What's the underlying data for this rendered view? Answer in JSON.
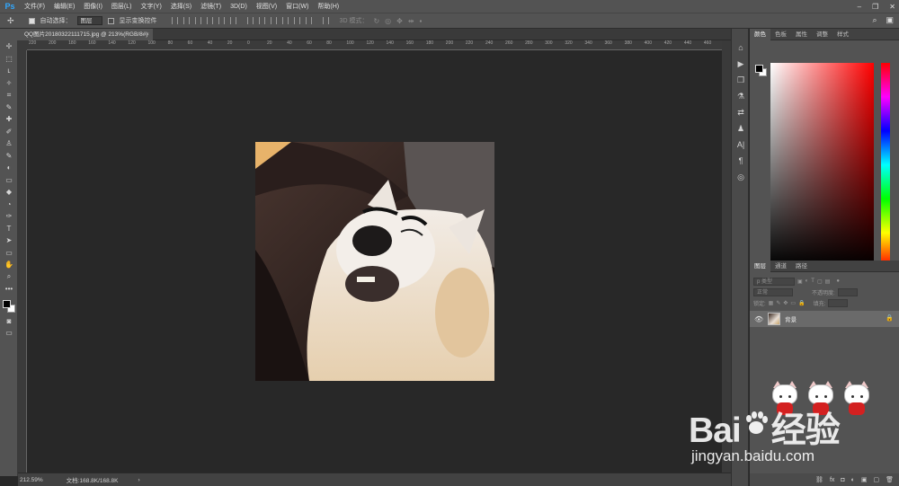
{
  "app": {
    "logo": "Ps"
  },
  "menu": {
    "items": [
      "文件(F)",
      "编辑(E)",
      "图像(I)",
      "图层(L)",
      "文字(Y)",
      "选择(S)",
      "滤镜(T)",
      "3D(D)",
      "视图(V)",
      "窗口(W)",
      "帮助(H)"
    ]
  },
  "window_controls": {
    "minimize": "–",
    "restore": "❐",
    "close": "✕"
  },
  "options": {
    "tool_glyph": "✢",
    "auto_select_label": "自动选择：",
    "auto_select_value": "图层",
    "show_transform_label": "显示变换控件",
    "mode_3d_label": "3D 模式：",
    "search_glyph": "⌕",
    "workspace_glyph": "▣"
  },
  "document": {
    "tab_title": "QQ图片20180322111715.jpg @ 213%(RGB/8#)",
    "close_glyph": "×"
  },
  "ruler": {
    "top_labels": [
      "220",
      "200",
      "180",
      "160",
      "140",
      "120",
      "100",
      "80",
      "60",
      "40",
      "20",
      "0",
      "20",
      "40",
      "60",
      "80",
      "100",
      "120",
      "140",
      "160",
      "180",
      "200",
      "220",
      "240",
      "260",
      "280",
      "300",
      "320",
      "340",
      "360",
      "380",
      "400",
      "420",
      "440",
      "460"
    ]
  },
  "status": {
    "zoom": "212.59%",
    "doc_info": "文档:168.8K/168.8K",
    "arrow": "›"
  },
  "tools": [
    "✢",
    "⬚",
    "ʟ",
    "✧",
    "⌗",
    "✎",
    "✚",
    "✐",
    "♙",
    "✎",
    "◐",
    "▭",
    "◆",
    "◔",
    "✑",
    "T",
    "➤",
    "▭",
    "✋",
    "⌕",
    "•••"
  ],
  "dock": [
    "⌂",
    "▶",
    "❒",
    "⚗",
    "⇄",
    "♟",
    "A|",
    "¶",
    "◎"
  ],
  "color_panel": {
    "tabs": [
      "颜色",
      "色板",
      "属性",
      "调整",
      "样式"
    ],
    "active_tab": "颜色",
    "foreground": "#000000",
    "background": "#ffffff",
    "hue_color": "#ff0000"
  },
  "layers_panel": {
    "tabs": [
      "图层",
      "通道",
      "路径"
    ],
    "active_tab": "图层",
    "kind_filter": "p 类型",
    "blend_mode": "正常",
    "opacity_label": "不透明度:",
    "lock_label": "锁定:",
    "fill_label": "填充:",
    "layers": [
      {
        "name": "背景",
        "visible": true,
        "locked": true
      }
    ],
    "bottom_icons": [
      "⛓",
      "fx",
      "◘",
      "◐",
      "▣",
      "▢",
      "🗑"
    ]
  },
  "watermark": {
    "logo_text": "Bai",
    "logo_text_2": "经验",
    "url": "jingyan.baidu.com"
  }
}
